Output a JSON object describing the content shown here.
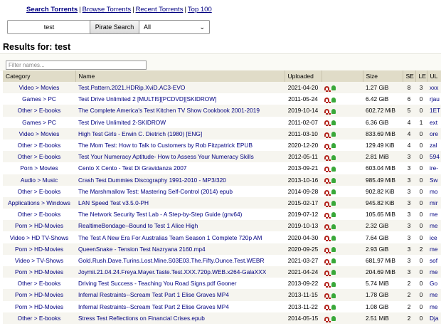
{
  "nav": {
    "items": [
      {
        "label": "Search Torrents",
        "active": true
      },
      {
        "label": "Browse Torrents",
        "active": false
      },
      {
        "label": "Recent Torrents",
        "active": false
      },
      {
        "label": "Top 100",
        "active": false
      }
    ],
    "separator": "|"
  },
  "search": {
    "value": "test",
    "button_label": "Pirate Search",
    "category_selected": "All",
    "chevron": "⌄"
  },
  "results": {
    "title": "Results for: test",
    "filter_placeholder": "Filter names...",
    "columns": {
      "category": "Category",
      "name": "Name",
      "uploaded": "Uploaded",
      "size": "Size",
      "se": "SE",
      "le": "LE",
      "ul": "UL"
    },
    "rows": [
      {
        "category": "Video > Movies",
        "name": "Test.Pattern.2021.HDRip.XviD.AC3-EVO",
        "uploaded": "2021-04-20",
        "size": "1.27 GiB",
        "se": "8",
        "le": "3",
        "ul": "xxx"
      },
      {
        "category": "Games > PC",
        "name": "Test Drive Unlimited 2 [MULTI5][PCDVD][SKIDROW]",
        "uploaded": "2011-05-24",
        "size": "6.42 GiB",
        "se": "6",
        "le": "0",
        "ul": "rjau"
      },
      {
        "category": "Other > E-books",
        "name": "The Complete America's Test Kitchen TV Show Cookbook 2001-2019",
        "uploaded": "2019-10-14",
        "size": "602.72 MiB",
        "se": "5",
        "le": "0",
        "ul": "1ET"
      },
      {
        "category": "Games > PC",
        "name": "Test Drive Unlimited 2-SKIDROW",
        "uploaded": "2011-02-07",
        "size": "6.36 GiB",
        "se": "4",
        "le": "1",
        "ul": "ext"
      },
      {
        "category": "Video > Movies",
        "name": "High Test Girls - Erwin C. Dietrich (1980) [ENG]",
        "uploaded": "2011-03-10",
        "size": "833.69 MiB",
        "se": "4",
        "le": "0",
        "ul": "ore"
      },
      {
        "category": "Other > E-books",
        "name": "The Mom Test: How to Talk to Customers by Rob Fitzpatrick EPUB",
        "uploaded": "2020-12-20",
        "size": "129.49 KiB",
        "se": "4",
        "le": "0",
        "ul": "zal"
      },
      {
        "category": "Other > E-books",
        "name": "Test Your Numeracy Aptitude- How to Assess Your Numeracy Skills",
        "uploaded": "2012-05-11",
        "size": "2.81 MiB",
        "se": "3",
        "le": "0",
        "ul": "594"
      },
      {
        "category": "Porn > Movies",
        "name": "Cento X Cento - Test Di Gravidanza 2007",
        "uploaded": "2013-09-21",
        "size": "603.04 MiB",
        "se": "3",
        "le": "0",
        "ul": "ire-"
      },
      {
        "category": "Audio > Music",
        "name": "Crash Test Dummies Discography 1991-2010 - MP3/320",
        "uploaded": "2013-10-16",
        "size": "985.49 MiB",
        "se": "3",
        "le": "0",
        "ul": "Sw"
      },
      {
        "category": "Other > E-books",
        "name": "The Marshmallow Test: Mastering Self-Control (2014) epub",
        "uploaded": "2014-09-28",
        "size": "902.82 KiB",
        "se": "3",
        "le": "0",
        "ul": "mo"
      },
      {
        "category": "Applications > Windows",
        "name": "LAN Speed Test v3.5.0-PH",
        "uploaded": "2015-02-17",
        "size": "945.82 KiB",
        "se": "3",
        "le": "0",
        "ul": "mir"
      },
      {
        "category": "Other > E-books",
        "name": "The Network Security Test Lab - A Step-by-Step Guide (gnv64)",
        "uploaded": "2019-07-12",
        "size": "105.65 MiB",
        "se": "3",
        "le": "0",
        "ul": "me"
      },
      {
        "category": "Porn > HD-Movies",
        "name": "RealtimeBondage--Bound to Test 1 Alice High",
        "uploaded": "2019-10-13",
        "size": "2.32 GiB",
        "se": "3",
        "le": "0",
        "ul": "me"
      },
      {
        "category": "Video > HD TV-Shows",
        "name": "The Test A New Era For Australias Team Season 1 Complete 720p AM",
        "uploaded": "2020-04-30",
        "size": "7.64 GiB",
        "se": "3",
        "le": "0",
        "ul": "ice"
      },
      {
        "category": "Porn > HD-Movies",
        "name": "QueenSnake - Tension Test Nazryana 2160.mp4",
        "uploaded": "2020-09-25",
        "size": "2.93 GiB",
        "se": "3",
        "le": "2",
        "ul": "me"
      },
      {
        "category": "Video > TV-Shows",
        "name": "Gold.Rush.Dave.Turins.Lost.Mine.S03E03.The.Fifty.Ounce.Test.WEBR",
        "uploaded": "2021-03-27",
        "size": "681.97 MiB",
        "se": "3",
        "le": "0",
        "ul": "sof"
      },
      {
        "category": "Porn > HD-Movies",
        "name": "Joymii.21.04.24.Freya.Mayer.Taste.Test.XXX.720p.WEB.x264-GalaXXX",
        "uploaded": "2021-04-24",
        "size": "204.69 MiB",
        "se": "3",
        "le": "0",
        "ul": "me"
      },
      {
        "category": "Other > E-books",
        "name": "Driving Test Success - Teaching You Road Signs.pdf Gooner",
        "uploaded": "2013-09-22",
        "size": "5.74 MiB",
        "se": "2",
        "le": "0",
        "ul": "Go"
      },
      {
        "category": "Porn > HD-Movies",
        "name": "Infernal Restraints--Scream Test Part 1 Elise Graves MP4",
        "uploaded": "2013-11-15",
        "size": "1.78 GiB",
        "se": "2",
        "le": "0",
        "ul": "me"
      },
      {
        "category": "Porn > HD-Movies",
        "name": "Infernal Restraints--Scream Test Part 2 Elise Graves MP4",
        "uploaded": "2013-11-22",
        "size": "1.08 GiB",
        "se": "2",
        "le": "0",
        "ul": "me"
      },
      {
        "category": "Other > E-books",
        "name": "Stress Test Reflections on Financial Crises.epub",
        "uploaded": "2014-05-15",
        "size": "2.51 MiB",
        "se": "2",
        "le": "0",
        "ul": "Dja"
      }
    ]
  },
  "colors": {
    "link": "#000080",
    "header_bg": "#e0dcc8",
    "row_alt": "#f6f5ef",
    "magnet_icon": "#b3261e",
    "seed_icon": "#39a839"
  },
  "icons": [
    "magnet-icon",
    "uploader-status-icon",
    "chevron-down-icon"
  ]
}
